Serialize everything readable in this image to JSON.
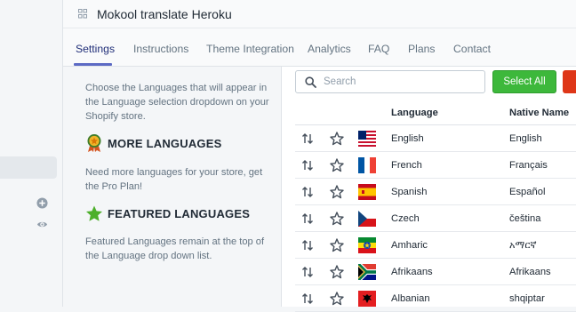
{
  "app": {
    "title": "Mokool translate Heroku"
  },
  "tabs": [
    {
      "label": "Settings",
      "active": true
    },
    {
      "label": "Instructions"
    },
    {
      "label": "Theme Integration"
    },
    {
      "label": "Analytics"
    },
    {
      "label": "FAQ"
    },
    {
      "label": "Plans"
    },
    {
      "label": "Contact"
    }
  ],
  "sidebar": {
    "intro": "Choose the Languages that will appear in the Language selection dropdown on your Shopify store.",
    "more_languages": {
      "title": "MORE LANGUAGES",
      "text": "Need more languages for your store, get the Pro Plan!",
      "icon": "medal-icon"
    },
    "featured_languages": {
      "title": "FEATURED LANGUAGES",
      "text": "Featured Languages remain at the top of the Language drop down list.",
      "icon": "star-icon"
    }
  },
  "search": {
    "placeholder": "Search",
    "value": ""
  },
  "buttons": {
    "select_all": "Select All"
  },
  "colors": {
    "accent": "#5c6ac4",
    "primary_button": "#3db83b",
    "danger_button": "#de3618"
  },
  "table": {
    "columns": [
      "Language",
      "Native Name"
    ],
    "rows": [
      {
        "language": "English",
        "native": "English",
        "flag": "us-flag"
      },
      {
        "language": "French",
        "native": "Français",
        "flag": "france-flag"
      },
      {
        "language": "Spanish",
        "native": "Español",
        "flag": "spain-flag"
      },
      {
        "language": "Czech",
        "native": "čeština",
        "flag": "czech-flag"
      },
      {
        "language": "Amharic",
        "native": "አማርኛ",
        "flag": "ethiopia-flag"
      },
      {
        "language": "Afrikaans",
        "native": "Afrikaans",
        "flag": "south-africa-flag"
      },
      {
        "language": "Albanian",
        "native": "shqiptar",
        "flag": "albania-flag"
      }
    ]
  }
}
